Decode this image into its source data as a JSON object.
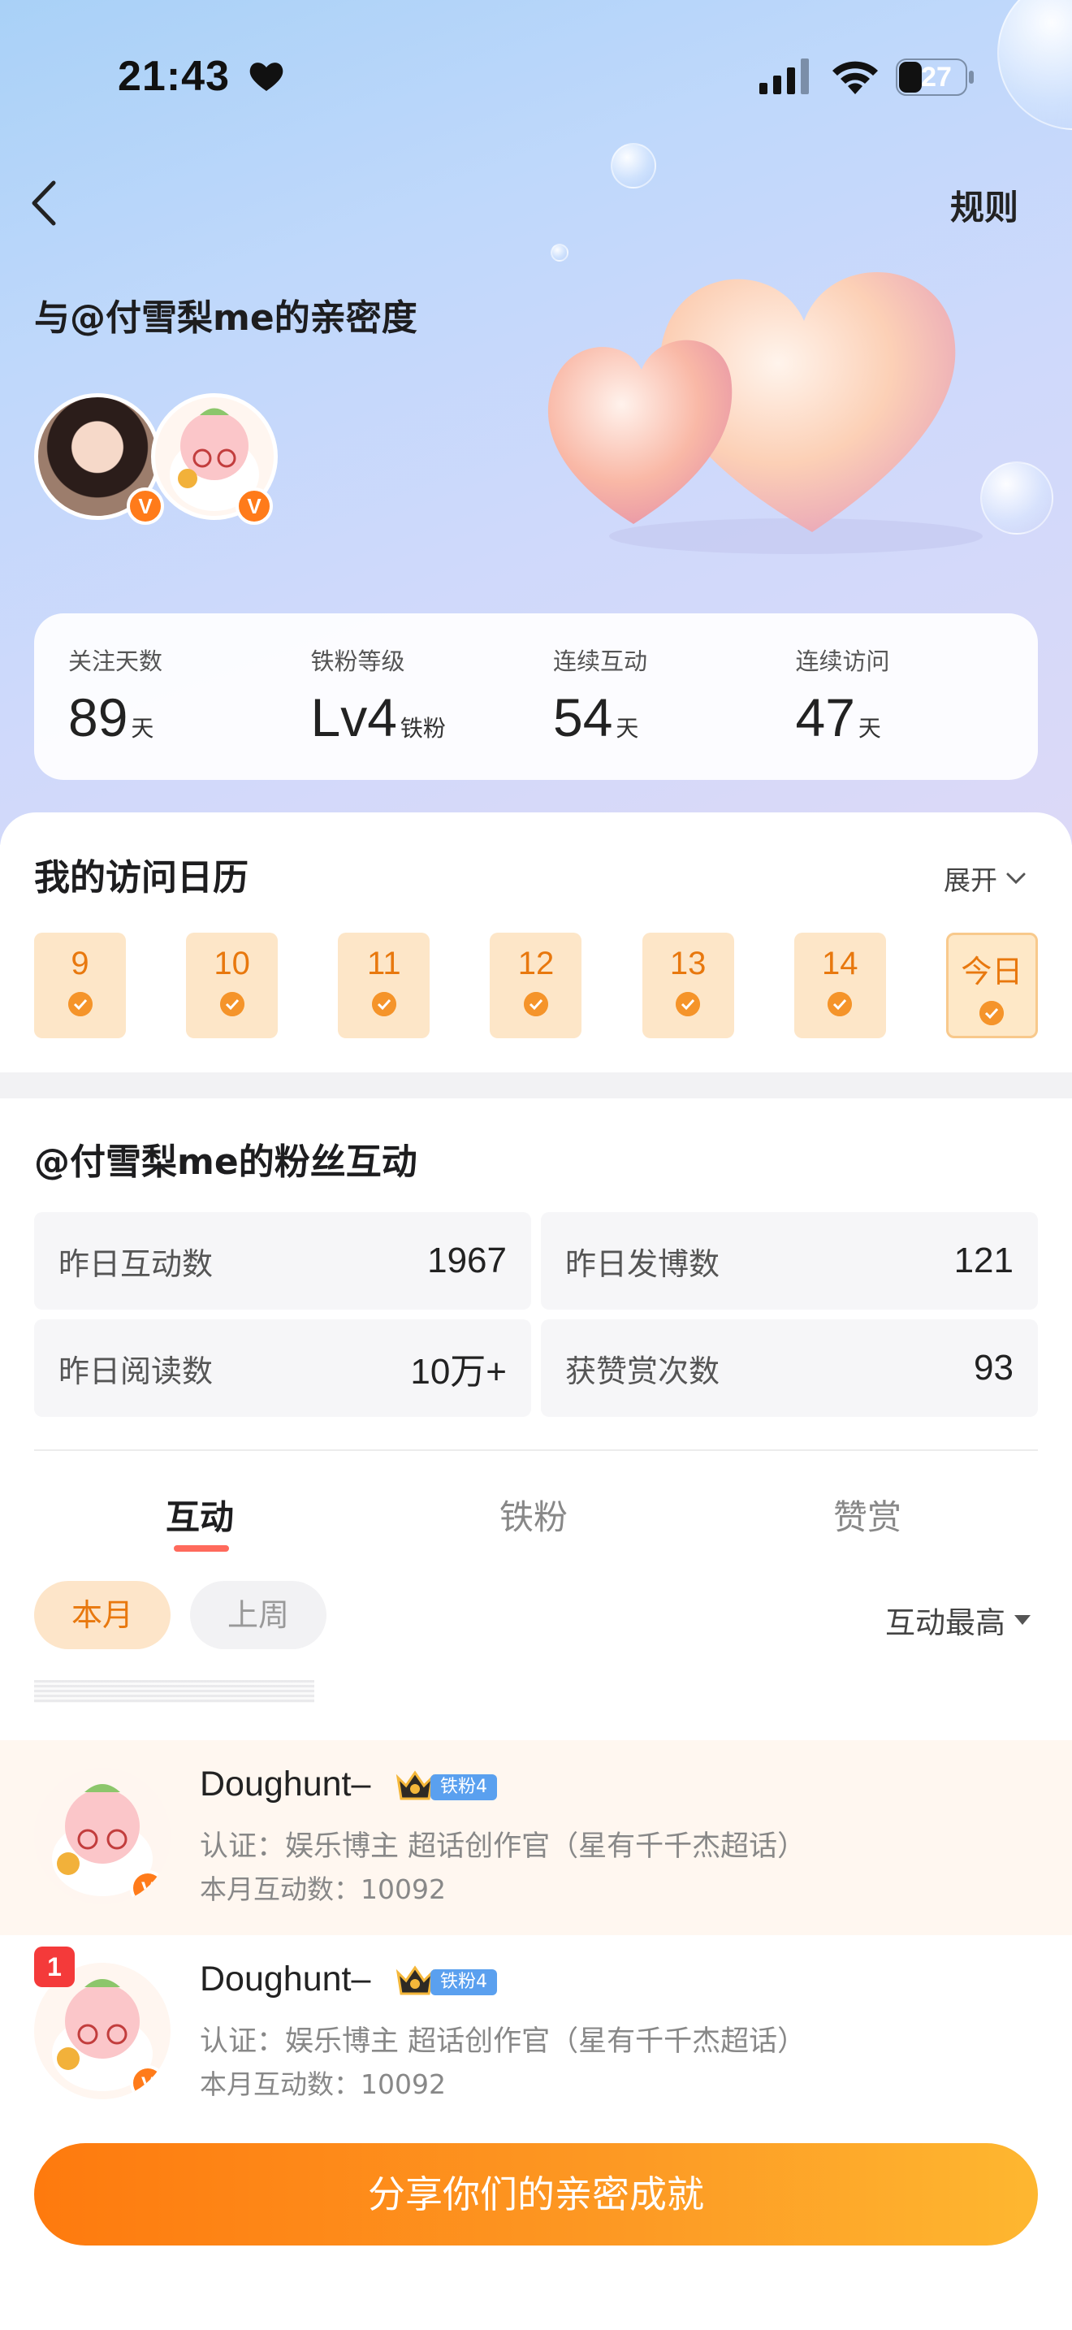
{
  "status_bar": {
    "time": "21:43",
    "battery": "27"
  },
  "nav": {
    "rules_label": "规则"
  },
  "hero": {
    "title": "与@付雪梨me的亲密度"
  },
  "stats": [
    {
      "label": "关注天数",
      "value": "89",
      "unit": "天"
    },
    {
      "label": "铁粉等级",
      "value": "Lv4",
      "unit": "铁粉"
    },
    {
      "label": "连续互动",
      "value": "54",
      "unit": "天"
    },
    {
      "label": "连续访问",
      "value": "47",
      "unit": "天"
    }
  ],
  "calendar": {
    "title": "我的访问日历",
    "expand_label": "展开",
    "days": [
      "9",
      "10",
      "11",
      "12",
      "13",
      "14",
      "今日"
    ]
  },
  "fans": {
    "title": "@付雪梨me的粉丝互动",
    "metrics": [
      {
        "label": "昨日互动数",
        "value": "1967"
      },
      {
        "label": "昨日发博数",
        "value": "121"
      },
      {
        "label": "昨日阅读数",
        "value": "10万+"
      },
      {
        "label": "获赞赏次数",
        "value": "93"
      }
    ],
    "tabs": [
      "互动",
      "铁粉",
      "赞赏"
    ],
    "filters": [
      "本月",
      "上周"
    ],
    "sort_label": "互动最高",
    "list": [
      {
        "name": "Doughunt–",
        "badge": "铁粉4",
        "verify": "认证：娱乐博主 超话创作官（星有千千杰超话）",
        "count": "本月互动数：10092"
      },
      {
        "rank": "1",
        "name": "Doughunt–",
        "badge": "铁粉4",
        "verify": "认证：娱乐博主 超话创作官（星有千千杰超话）",
        "count": "本月互动数：10092"
      }
    ]
  },
  "share_label": "分享你们的亲密成就",
  "colors": {
    "accent": "#e8780e",
    "button": "#fd9a24",
    "badge_blue": "#5aa0ef",
    "rank_red": "#f43a3a"
  }
}
